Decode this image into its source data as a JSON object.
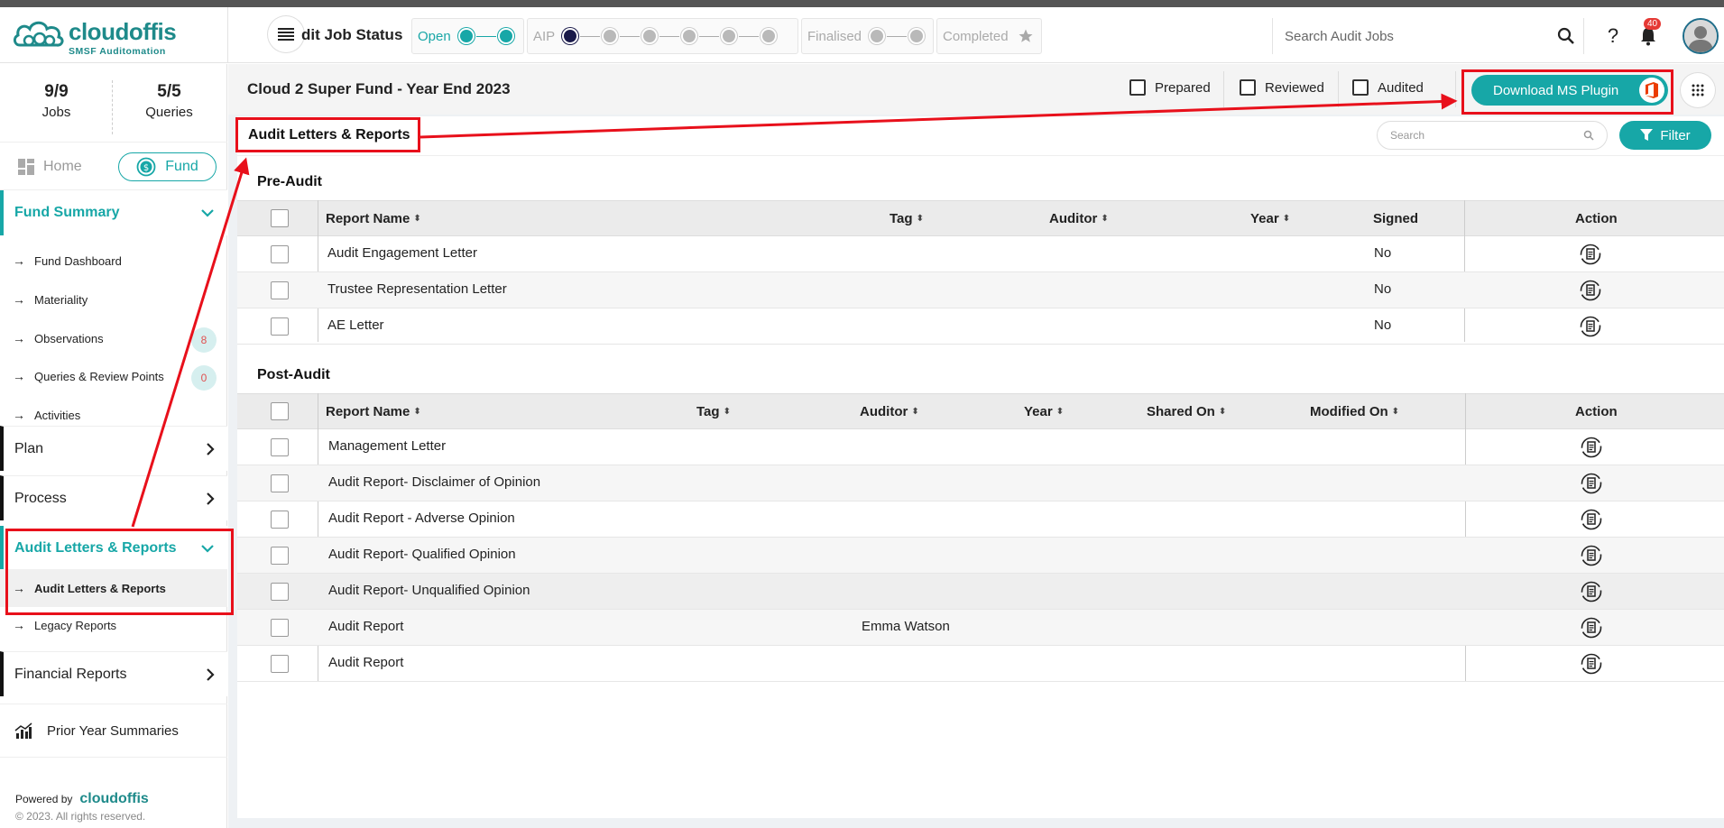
{
  "brand": {
    "name": "cloudoffis",
    "tagline": "SMSF Auditomation"
  },
  "header": {
    "job_status_title": "dit Job Status",
    "stages": [
      {
        "label": "Open"
      },
      {
        "label": "AIP"
      },
      {
        "label": "Finalised"
      },
      {
        "label": "Completed"
      }
    ],
    "search_placeholder": "Search Audit Jobs",
    "notification_count": "40"
  },
  "sidebar": {
    "jobs_count": "9/9",
    "jobs_label": "Jobs",
    "queries_count": "5/5",
    "queries_label": "Queries",
    "home_label": "Home",
    "fund_label": "Fund",
    "fund_summary": {
      "label": "Fund Summary",
      "items": [
        {
          "label": "Fund Dashboard"
        },
        {
          "label": "Materiality"
        },
        {
          "label": "Observations",
          "badge": "8"
        },
        {
          "label": "Queries & Review Points",
          "badge": "0"
        },
        {
          "label": "Activities"
        }
      ]
    },
    "plan_label": "Plan",
    "process_label": "Process",
    "audit_letters": {
      "label": "Audit Letters & Reports",
      "items": [
        {
          "label": "Audit Letters & Reports"
        },
        {
          "label": "Legacy Reports"
        }
      ]
    },
    "financial_reports_label": "Financial Reports",
    "prior_year_label": "Prior Year Summaries",
    "powered_by": "Powered by",
    "copyright": "© 2023. All rights reserved."
  },
  "fund_bar": {
    "title": "Cloud 2 Super Fund - Year End 2023",
    "prepared_label": "Prepared",
    "reviewed_label": "Reviewed",
    "audited_label": "Audited",
    "download_label": "Download MS Plugin"
  },
  "panel": {
    "title": "Audit Letters & Reports",
    "search_placeholder": "Search",
    "filter_label": "Filter"
  },
  "pre_audit": {
    "title": "Pre-Audit",
    "columns": {
      "report_name": "Report Name",
      "tag": "Tag",
      "auditor": "Auditor",
      "year": "Year",
      "signed": "Signed",
      "action": "Action"
    },
    "rows": [
      {
        "name": "Audit Engagement Letter",
        "tag": "",
        "auditor": "",
        "year": "",
        "signed": "No"
      },
      {
        "name": "Trustee Representation Letter",
        "tag": "",
        "auditor": "",
        "year": "",
        "signed": "No"
      },
      {
        "name": "AE Letter",
        "tag": "",
        "auditor": "",
        "year": "",
        "signed": "No"
      }
    ]
  },
  "post_audit": {
    "title": "Post-Audit",
    "columns": {
      "report_name": "Report Name",
      "tag": "Tag",
      "auditor": "Auditor",
      "year": "Year",
      "shared_on": "Shared On",
      "modified_on": "Modified On",
      "action": "Action"
    },
    "rows": [
      {
        "name": "Management Letter",
        "auditor": ""
      },
      {
        "name": "Audit Report- Disclaimer of Opinion",
        "auditor": ""
      },
      {
        "name": "Audit Report - Adverse Opinion",
        "auditor": ""
      },
      {
        "name": "Audit Report- Qualified Opinion",
        "auditor": ""
      },
      {
        "name": "Audit Report- Unqualified Opinion",
        "auditor": ""
      },
      {
        "name": "Audit Report",
        "auditor": "Emma Watson"
      },
      {
        "name": "Audit Report",
        "auditor": ""
      }
    ]
  },
  "colors": {
    "accent": "#17a7a7",
    "annotation": "#e8101b",
    "brand": "#1e8a8a"
  }
}
